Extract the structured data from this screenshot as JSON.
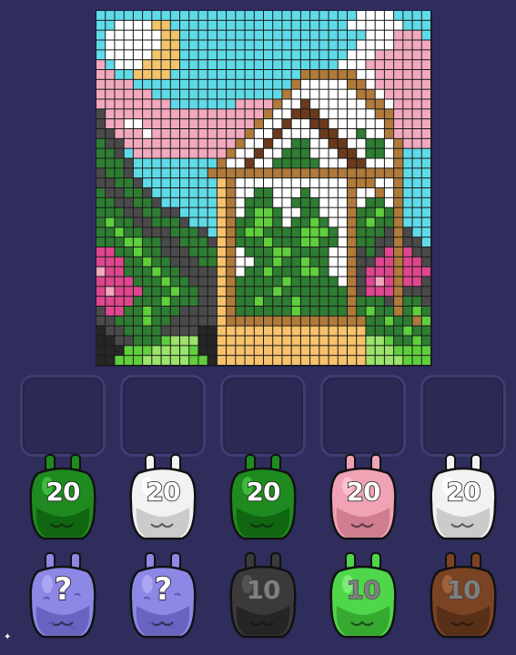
{
  "palette": {
    "K": "#262626",
    "D": "#4a4a4a",
    "W": "#ffffff",
    "C": "#5fdbe8",
    "P": "#f2a9bd",
    "Y": "#f3c46b",
    "B": "#b07a3a",
    "O": "#f7c26b",
    "G": "#2e7d32",
    "g": "#5fcf3c",
    "L": "#9be36b",
    "M": "#e0468e",
    "R": "#6b3a1c",
    "T": "#3f2a14"
  },
  "board": [
    "CCCCCCCCCCCCCCCCCCCCCCCCCCCCWWWWCCCC",
    "CCWWWWYYCCCCCCCCCCCCCCCCCCCWWWWWWCCC",
    "CWWWWWWYYCCCCCCCCCCCCCCCCCCCCWWWPPPC",
    "CWWWWWWYYCCCCCCCCCCCCCCCCCCCWWWWPPPP",
    "CWWWWWYYYCCCCCCCCCCCCCCCCCCWWWPPPPPP",
    "PCWWWYYYYCCCCCCCCCCCCCCCCCWWWPPPPPPP",
    "PPCCYYYYCCCCCCCCCCCCCCBBBBBBWWPPPPPP",
    "PPPPCCCCCCCCCCCCCCCCCBWWWWWBBWPPPPPP",
    "PPPPPPCCCCCCCCCCCCCCBWWWWWWWBBWPPPPP",
    "PPPPPPPPCCCCCCCPPPPBWWRWWWWWWBBWPPPP",
    "DPPPPPPPPPPPPPPPPPBWWRRRWWWWWWBBPPPP",
    "DPPWWPPPPPPPPPPPPBWWRWWRRWWWWWWBPPPP",
    "DDPPPWPPPPPPPPPPBWWRWWWWRRWWGWWBPPPP",
    "GDDPPPPPPPPPPPPBWWRWWGGWWRRWWGGWBPPP",
    "GGDCPPPPPPPPPPBWWRWWGGGWWWRRWGGWBCCC",
    "GGGDCCCCCCCCCBWWRWWGGGGGWWWRRWWWBCCC",
    "DGGDCCCCCCCCBBBBBBBBBBBBBBBBBBBBBCCC",
    "DDGGDCCCCCCCCOBWWWWWWWWWWWWBBBWWBCCC",
    "GDDGGDCCCCCCCOBWWGGWWWGWWWWBWWBWBCCC",
    "GGDDGGDCCCCCCOBWGGGWWGGGWWWBWGGWBCCC",
    "GGGDDGGDDCCCCOBWGggGWWGGWWWBGGgGBCCC",
    "GgGGDDGGGDCCCOBGGggGWGGgGWWBGgGGBCCC",
    "GGgGGDDDGGGDCOBGggGGGGgggGWBGGGDBDCC",
    "GGGggGGDDGGGDOBGGGgGGGggGGWBGGDDBDDC",
    "MMGGgGGDDDGGGOBWGGGggGGGGWWBDGDMBMDD",
    "MMMGGgGGDDDGGOBWWGGgGGgGGWWBDDMMBMMD",
    "PMMGGGgGGDDDDOBWGGgGGGggGWWBDMMMBMMM",
    "MMMMGGGgGGDDDOBGGGGGgGGGGGWBDMPMBMMD",
    "MPMMMGGGgGGDDOBGGGGgGGGGGGGBDMMMBDDD",
    "MMMMGGGgGGGDDOBGGgGGGgGGGGGBGGGDBGGD",
    "DMMGGgGGGDDDDOBGGGGGGgGGGGGBGgGGBGgG",
    "DDGGGgGGDDDDDOBBBBBBBBBBBBBBBGGgGGBgG",
    "KDDGGGGDDDDKKOOOOOOOOOOOOOOOOGGGGgGG",
    "KKDDGGGgLLLKKOOOOOOOOOOOOOOOOLLgGGgG",
    "KKKgggLLLLgKKOOOOOOOOOOOOOOOOLLLgggg",
    "KKgggLLLLLggKOOOOOOOOOOOOOOOOLLLLggg"
  ],
  "slots": [
    {},
    {},
    {},
    {},
    {}
  ],
  "row1": [
    {
      "count": "20",
      "color": "#1f8a1f",
      "shade": "#0e5a0e",
      "hi": "#45c445"
    },
    {
      "count": "20",
      "color": "#f2f2f2",
      "shade": "#bdbdbd",
      "hi": "#ffffff"
    },
    {
      "count": "20",
      "color": "#1f8a1f",
      "shade": "#0e5a0e",
      "hi": "#45c445"
    },
    {
      "count": "20",
      "color": "#f0a3b5",
      "shade": "#c56f85",
      "hi": "#ffc7d4"
    },
    {
      "count": "20",
      "color": "#f2f2f2",
      "shade": "#bdbdbd",
      "hi": "#ffffff"
    }
  ],
  "row2": [
    {
      "count": "?",
      "color": "#8d87e6",
      "shade": "#5d57b5",
      "hi": "#b3aef5",
      "mystery": true
    },
    {
      "count": "?",
      "color": "#8d87e6",
      "shade": "#5d57b5",
      "hi": "#b3aef5",
      "mystery": true
    },
    {
      "count": "10",
      "color": "#3a3a3a",
      "shade": "#1f1f1f",
      "hi": "#5a5a5a"
    },
    {
      "count": "10",
      "color": "#4fd64a",
      "shade": "#2c9a28",
      "hi": "#8af085"
    },
    {
      "count": "10",
      "color": "#7a4424",
      "shade": "#4e2813",
      "hi": "#a96a40"
    }
  ]
}
